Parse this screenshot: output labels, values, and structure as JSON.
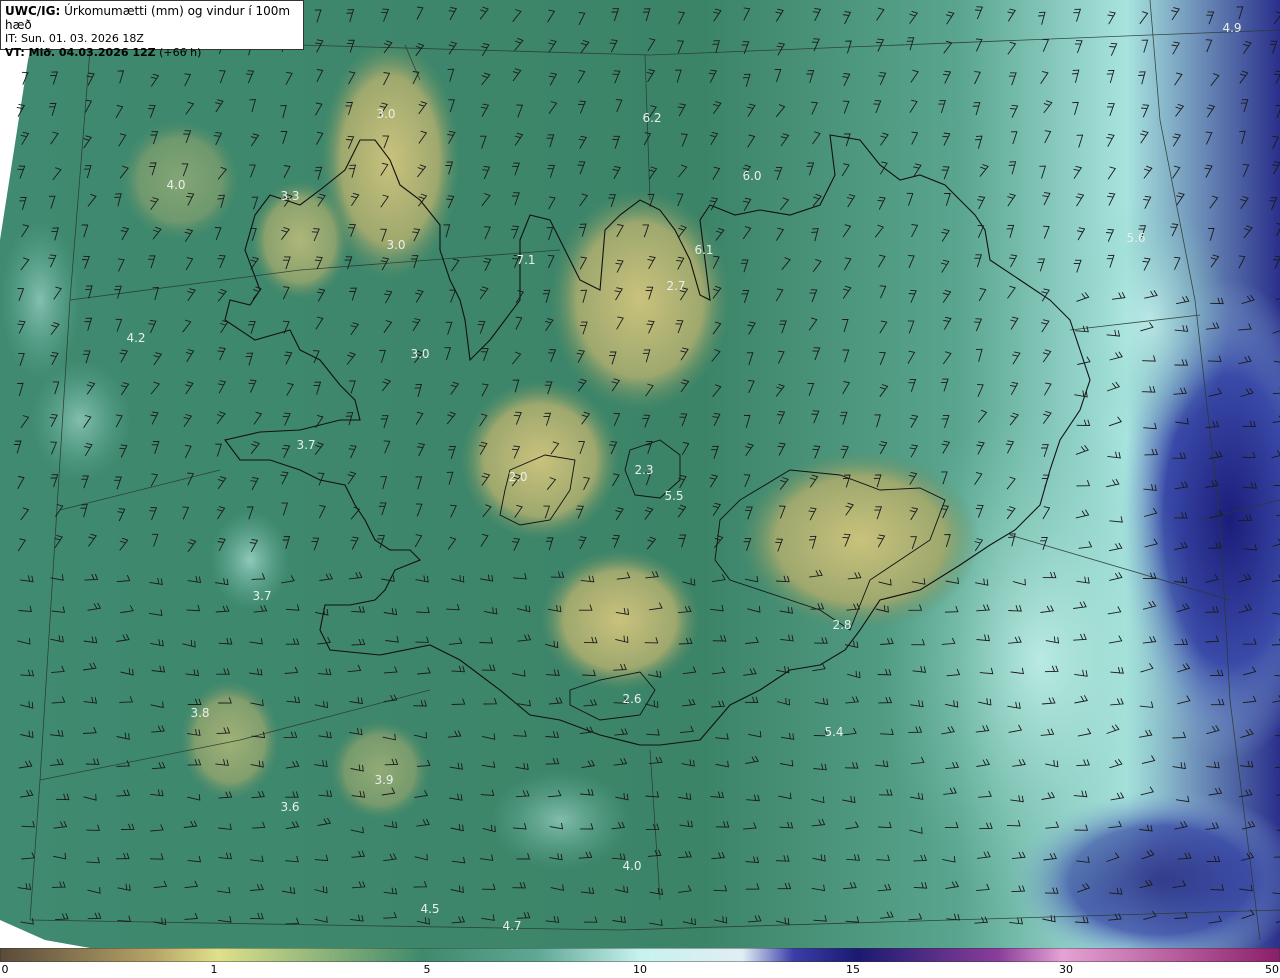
{
  "header": {
    "model_label": "UWC/IG:",
    "title": "Úrkomumætti (mm) og vindur í 100m hæð",
    "init_time": "IT: Sun. 01. 03. 2026 18Z",
    "valid_label": "VT: Mið. 04.03.2026 12Z",
    "lead_time": "(+66 h)"
  },
  "colors": {
    "land_low": "#c4c27a",
    "sea_mid": "#3f8a70",
    "high_cyan": "#b6ece8",
    "deep_blue": "#26288a",
    "coastline": "#111111"
  },
  "colorbar": {
    "ticks": [
      "0",
      "1",
      "5",
      "10",
      "15",
      "30",
      "50"
    ],
    "ramp": [
      "#5a4a3a",
      "#c7b36a",
      "#dfe08a",
      "#3e8a6c",
      "#5fa894",
      "#c7f2ee",
      "#e0eef4",
      "#3a3ea8",
      "#1a1a70",
      "#8a3e9a",
      "#e5a2d4",
      "#8a1e6a"
    ]
  },
  "values": [
    {
      "label": "4.9"
    },
    {
      "label": "6.2"
    },
    {
      "label": "3.0"
    },
    {
      "label": "6.0"
    },
    {
      "label": "4.0"
    },
    {
      "label": "3.3"
    },
    {
      "label": "3.0"
    },
    {
      "label": "6.1"
    },
    {
      "label": "5.6"
    },
    {
      "label": "7.1"
    },
    {
      "label": "2.7"
    },
    {
      "label": "4.2"
    },
    {
      "label": "3.0"
    },
    {
      "label": "3.7"
    },
    {
      "label": "2.3"
    },
    {
      "label": "2.0"
    },
    {
      "label": "5.5"
    },
    {
      "label": "3.7"
    },
    {
      "label": "2.8"
    },
    {
      "label": "3.8"
    },
    {
      "label": "2.6"
    },
    {
      "label": "5.4"
    },
    {
      "label": "3.9"
    },
    {
      "label": "3.6"
    },
    {
      "label": "4.0"
    },
    {
      "label": "4.5"
    },
    {
      "label": "4.7"
    }
  ]
}
